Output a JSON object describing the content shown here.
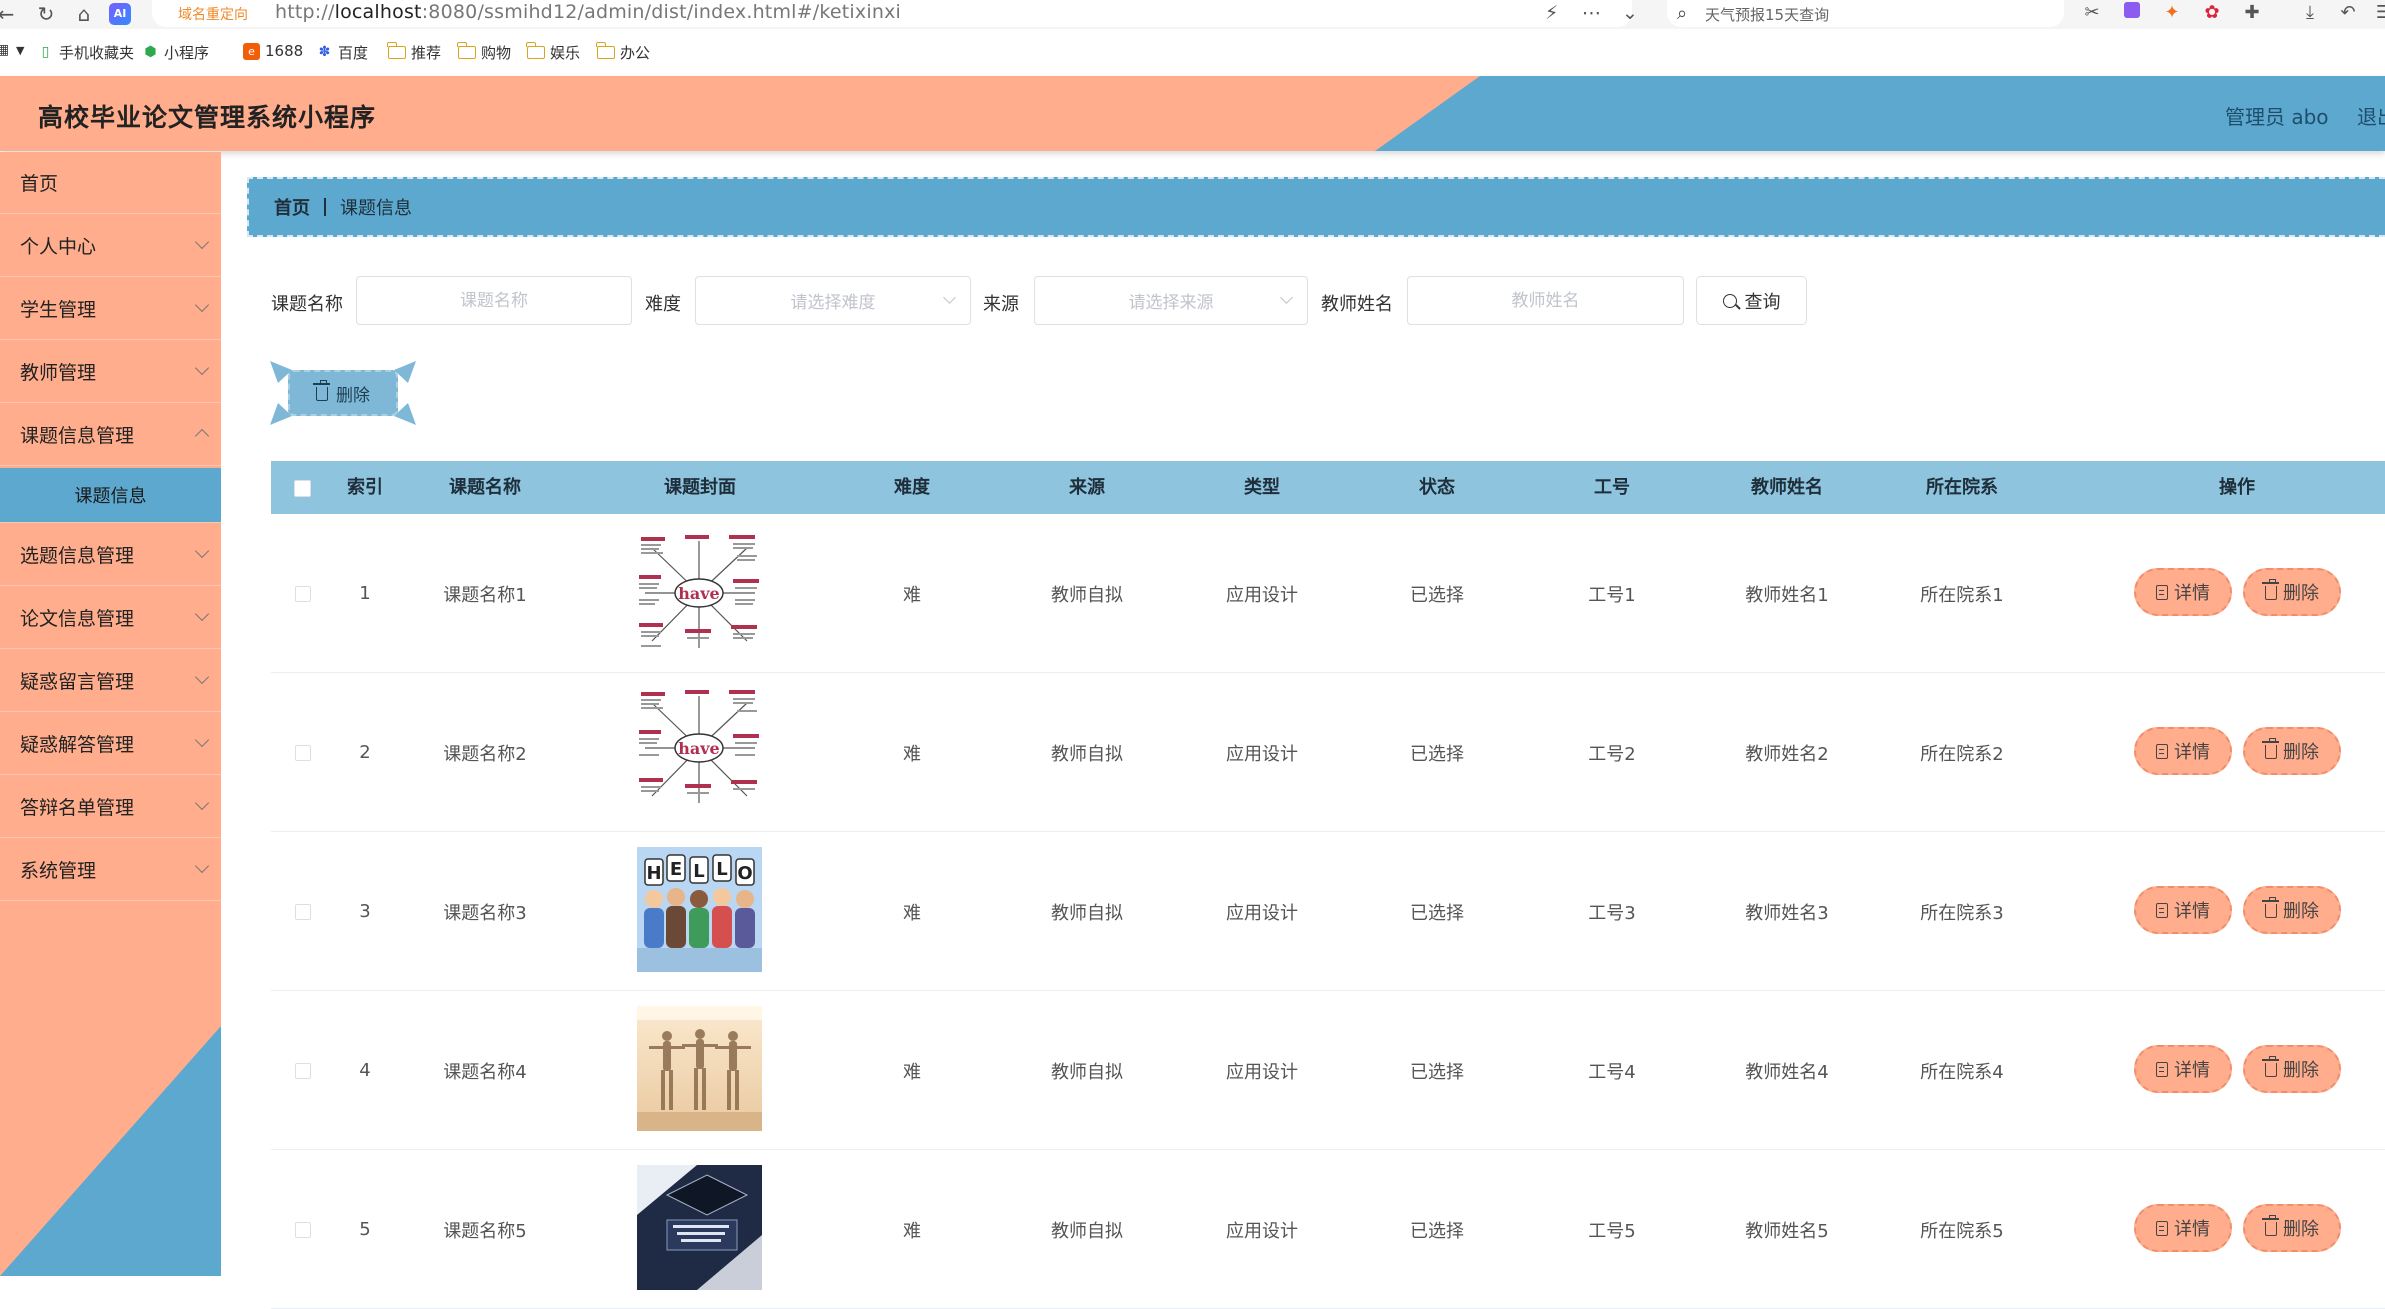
{
  "browser": {
    "redirect_tag": "域名重定向",
    "url_host": "localhost",
    "url_prefix": "http://",
    "url_rest": ":8080/ssmihd12/admin/dist/index.html#/ketixinxi",
    "search_text": "天气预报15天查询",
    "ai_badge": "AI",
    "bookmarks": [
      "手机收藏夹",
      "小程序",
      "1688",
      "百度",
      "推荐",
      "购物",
      "娱乐",
      "办公"
    ]
  },
  "header": {
    "title": "高校毕业论文管理系统小程序",
    "admin_label": "管理员 abo",
    "logout_label": "退出"
  },
  "sidebar": {
    "items": [
      {
        "label": "首页",
        "expandable": false
      },
      {
        "label": "个人中心",
        "expandable": true
      },
      {
        "label": "学生管理",
        "expandable": true
      },
      {
        "label": "教师管理",
        "expandable": true
      },
      {
        "label": "课题信息管理",
        "expandable": true
      },
      {
        "label": "课题信息",
        "sub": true
      },
      {
        "label": "选题信息管理",
        "expandable": true
      },
      {
        "label": "论文信息管理",
        "expandable": true
      },
      {
        "label": "疑惑留言管理",
        "expandable": true
      },
      {
        "label": "疑惑解答管理",
        "expandable": true
      },
      {
        "label": "答辩名单管理",
        "expandable": true
      },
      {
        "label": "系统管理",
        "expandable": true
      }
    ]
  },
  "breadcrumb": {
    "home": "首页",
    "current": "课题信息"
  },
  "search": {
    "title_label": "课题名称",
    "title_placeholder": "课题名称",
    "difficulty_label": "难度",
    "difficulty_placeholder": "请选择难度",
    "source_label": "来源",
    "source_placeholder": "请选择来源",
    "teacher_label": "教师姓名",
    "teacher_placeholder": "教师姓名",
    "query_label": "查询"
  },
  "bulk_delete_label": "删除",
  "table": {
    "headers": [
      "索引",
      "课题名称",
      "课题封面",
      "难度",
      "来源",
      "类型",
      "状态",
      "工号",
      "教师姓名",
      "所在院系",
      "操作"
    ],
    "rows": [
      {
        "index": "1",
        "title": "课题名称1",
        "cover": "have-diagram",
        "difficulty": "难",
        "source": "教师自拟",
        "type": "应用设计",
        "status": "已选择",
        "job_no": "工号1",
        "teacher": "教师姓名1",
        "department": "所在院系1"
      },
      {
        "index": "2",
        "title": "课题名称2",
        "cover": "have-diagram",
        "difficulty": "难",
        "source": "教师自拟",
        "type": "应用设计",
        "status": "已选择",
        "job_no": "工号2",
        "teacher": "教师姓名2",
        "department": "所在院系2"
      },
      {
        "index": "3",
        "title": "课题名称3",
        "cover": "hello-kids",
        "difficulty": "难",
        "source": "教师自拟",
        "type": "应用设计",
        "status": "已选择",
        "job_no": "工号3",
        "teacher": "教师姓名3",
        "department": "所在院系3"
      },
      {
        "index": "4",
        "title": "课题名称4",
        "cover": "dancers",
        "difficulty": "难",
        "source": "教师自拟",
        "type": "应用设计",
        "status": "已选择",
        "job_no": "工号4",
        "teacher": "教师姓名4",
        "department": "所在院系4"
      },
      {
        "index": "5",
        "title": "课题名称5",
        "cover": "book-cover",
        "difficulty": "难",
        "source": "教师自拟",
        "type": "应用设计",
        "status": "已选择",
        "job_no": "工号5",
        "teacher": "教师姓名5",
        "department": "所在院系5"
      }
    ],
    "detail_label": "详情",
    "delete_label": "删除"
  },
  "colors": {
    "salmon": "#ffad8c",
    "blue": "#5da8cf",
    "light_blue": "#8fc4de"
  }
}
